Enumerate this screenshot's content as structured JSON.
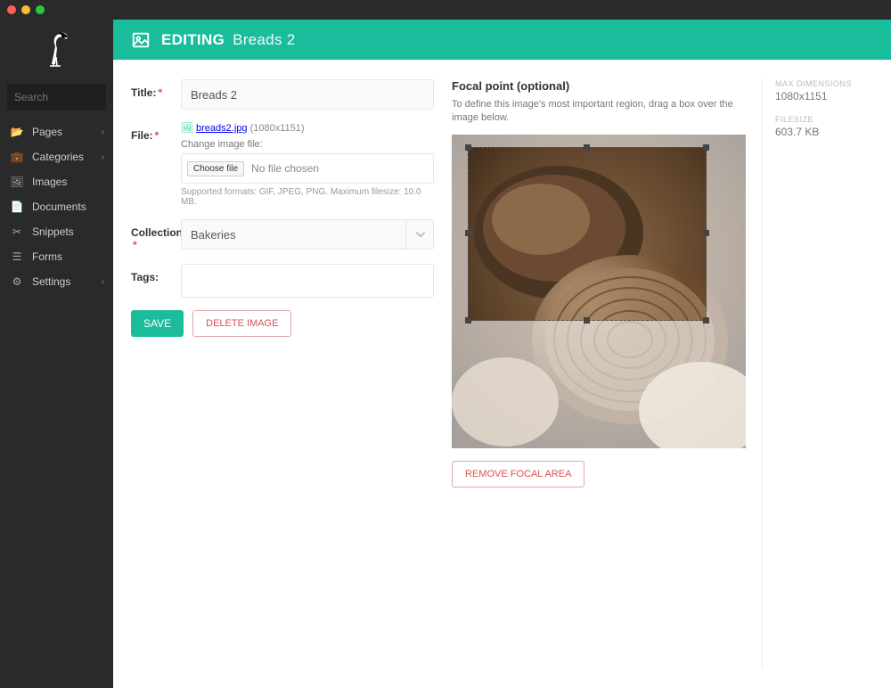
{
  "header": {
    "action": "EDITING",
    "title": "Breads 2"
  },
  "sidebar": {
    "search_placeholder": "Search",
    "items": [
      {
        "label": "Pages",
        "icon": "folder-open",
        "chev": true
      },
      {
        "label": "Categories",
        "icon": "briefcase",
        "chev": true
      },
      {
        "label": "Images",
        "icon": "image",
        "chev": false
      },
      {
        "label": "Documents",
        "icon": "document",
        "chev": false
      },
      {
        "label": "Snippets",
        "icon": "scissors",
        "chev": false
      },
      {
        "label": "Forms",
        "icon": "list",
        "chev": false
      },
      {
        "label": "Settings",
        "icon": "cog",
        "chev": true
      }
    ]
  },
  "form": {
    "title_label": "Title:",
    "title_value": "Breads 2",
    "file_label": "File:",
    "file_link": "breads2.jpg",
    "file_dims": "(1080x1151)",
    "change_image_label": "Change image file:",
    "choose_file_btn": "Choose file",
    "no_file_chosen": "No file chosen",
    "supported": "Supported formats: GIF, JPEG, PNG. Maximum filesize: 10.0 MB.",
    "collection_label": "Collection:",
    "collection_value": "Bakeries",
    "tags_label": "Tags:",
    "save_btn": "SAVE",
    "delete_btn": "DELETE IMAGE"
  },
  "focal": {
    "heading": "Focal point (optional)",
    "help": "To define this image's most important region, drag a box over the image below.",
    "remove_btn": "REMOVE FOCAL AREA"
  },
  "meta": {
    "maxdim_label": "MAX DIMENSIONS",
    "maxdim_value": "1080x1151",
    "filesize_label": "FILESIZE",
    "filesize_value": "603.7 KB"
  }
}
